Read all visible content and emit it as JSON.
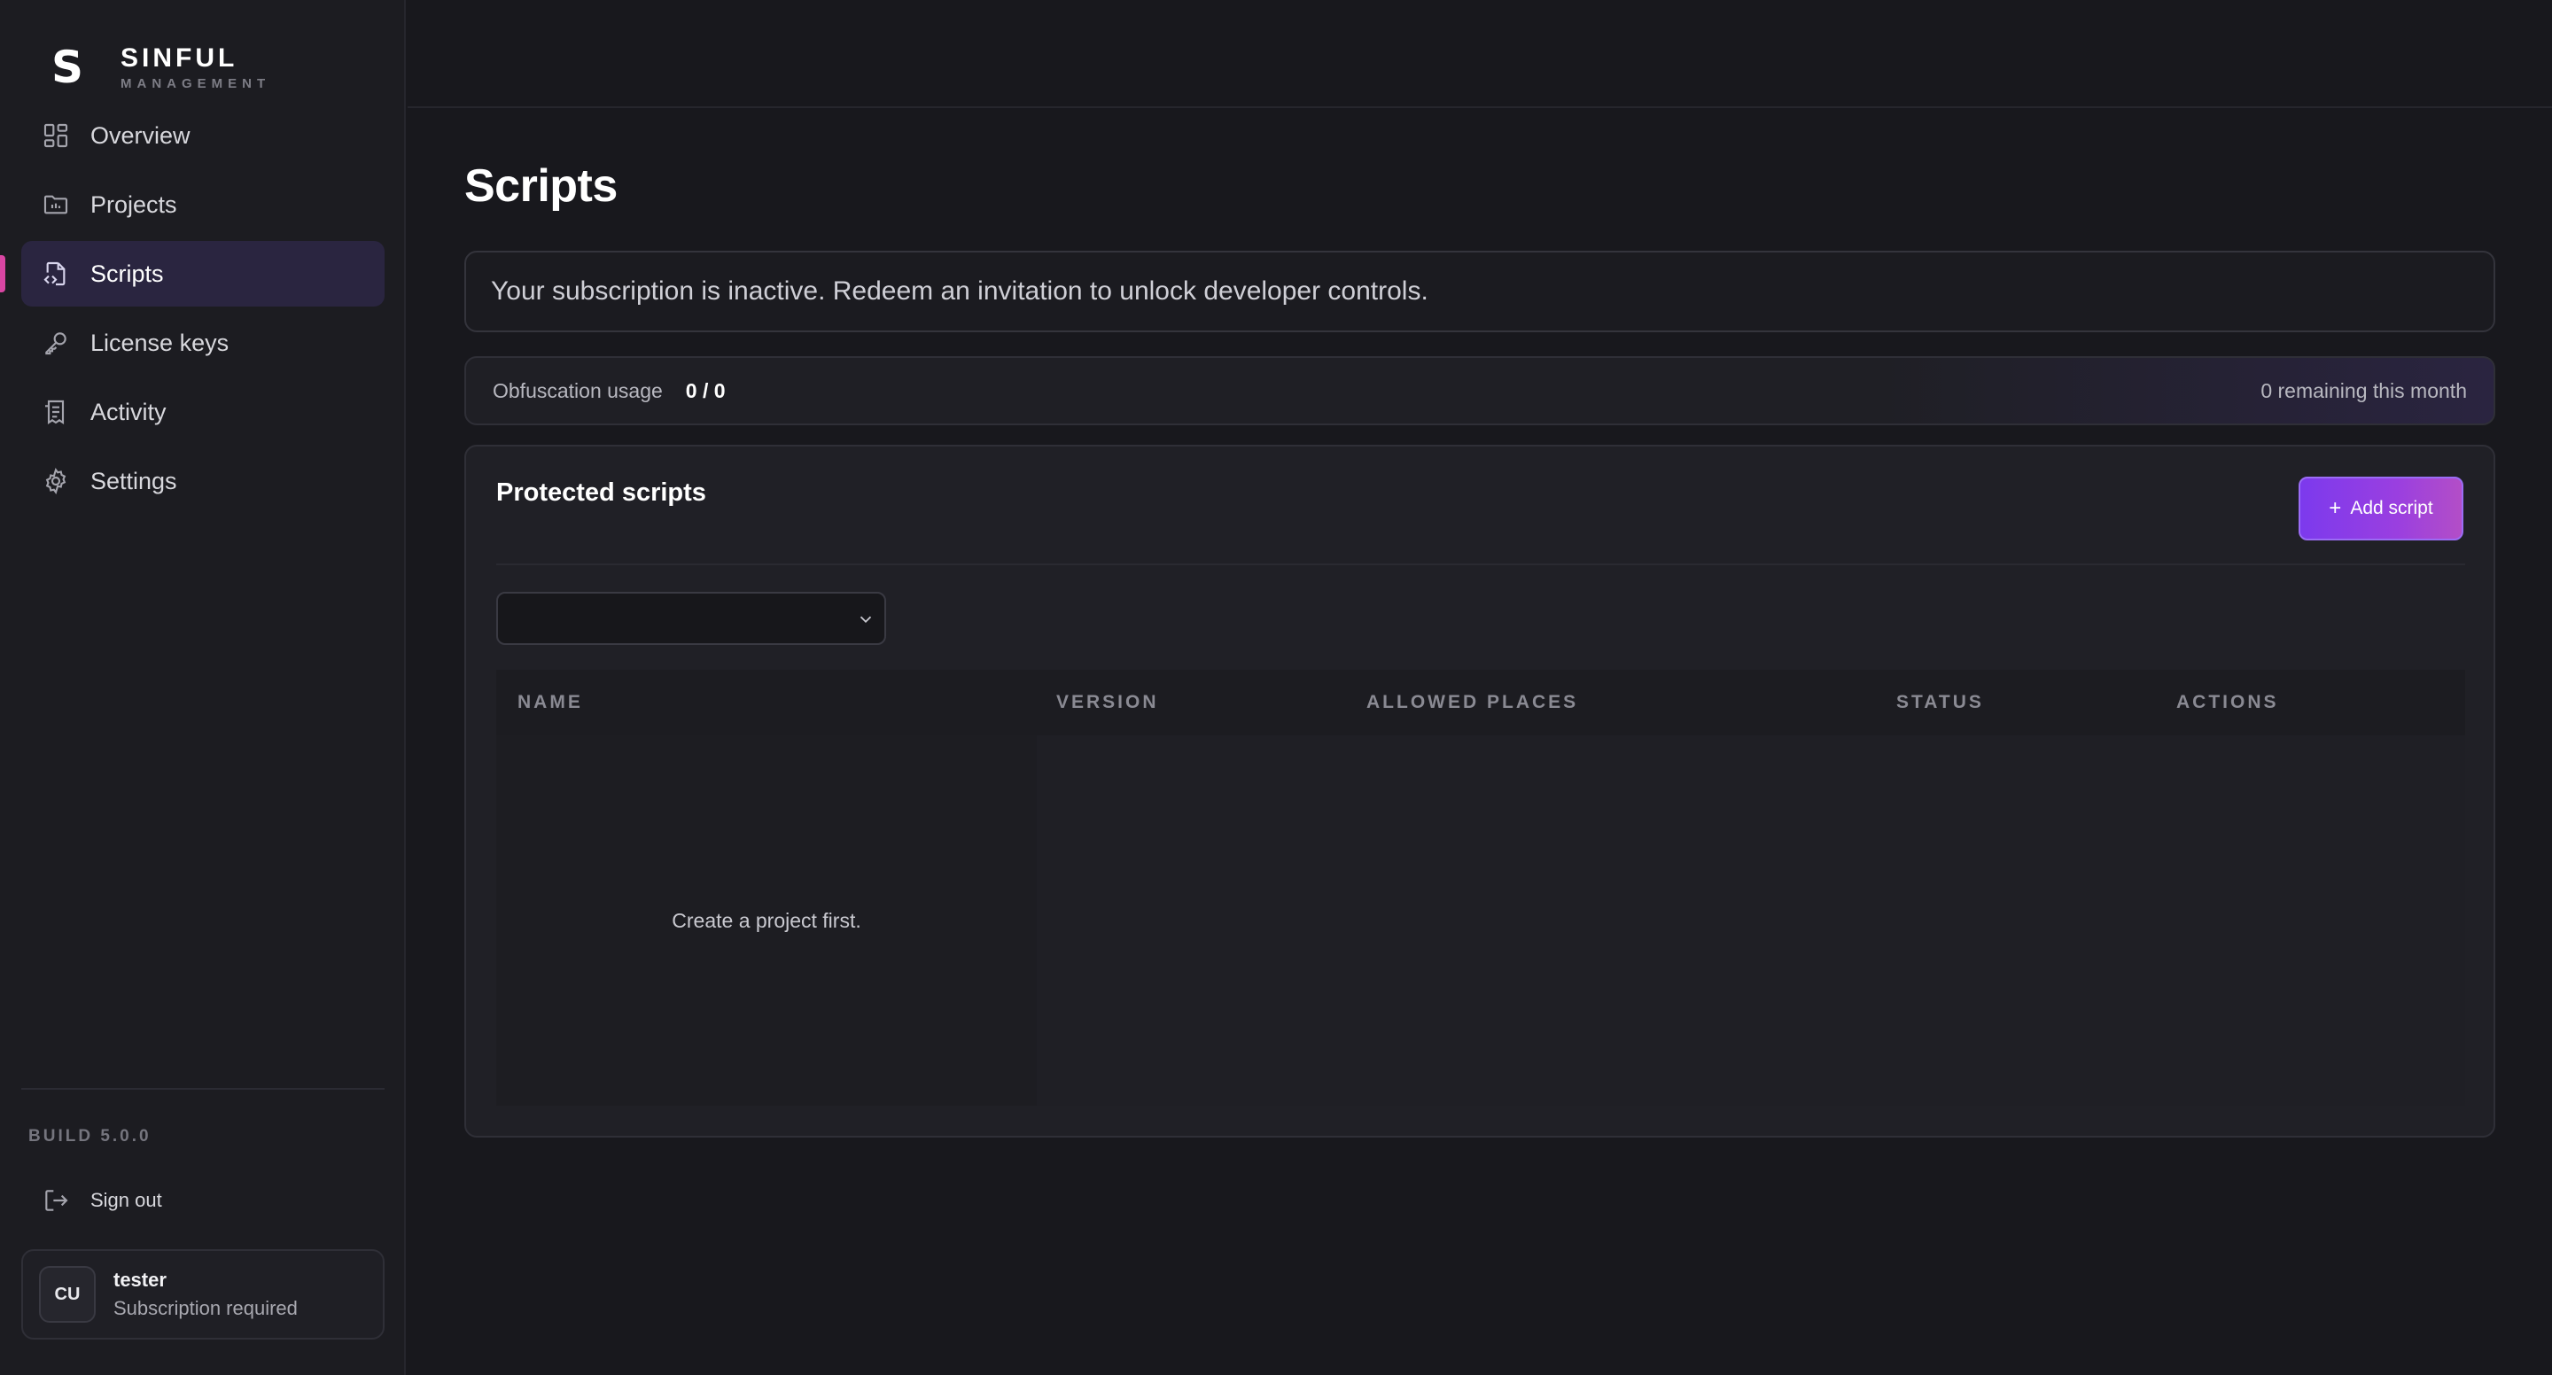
{
  "brand": {
    "logo_letter": "S",
    "title": "SINFUL",
    "subtitle": "MANAGEMENT"
  },
  "sidebar": {
    "items": [
      {
        "label": "Overview",
        "icon": "grid-icon",
        "active": false
      },
      {
        "label": "Projects",
        "icon": "folder-chart-icon",
        "active": false
      },
      {
        "label": "Scripts",
        "icon": "file-code-icon",
        "active": true
      },
      {
        "label": "License keys",
        "icon": "key-icon",
        "active": false
      },
      {
        "label": "Activity",
        "icon": "receipt-icon",
        "active": false
      },
      {
        "label": "Settings",
        "icon": "gear-icon",
        "active": false
      }
    ],
    "build": "BUILD 5.0.0",
    "sign_out": "Sign out",
    "user": {
      "initials": "CU",
      "name": "tester",
      "status": "Subscription required"
    }
  },
  "main": {
    "title": "Scripts",
    "banner": "Your subscription is inactive. Redeem an invitation to unlock developer controls.",
    "usage": {
      "label": "Obfuscation usage",
      "value": "0 / 0",
      "remaining": "0 remaining this month"
    },
    "panel": {
      "title": "Protected scripts",
      "add_button": "Add script",
      "add_icon": "plus-icon",
      "select_value": "",
      "columns": [
        "NAME",
        "VERSION",
        "ALLOWED PLACES",
        "STATUS",
        "ACTIONS"
      ],
      "empty_message": "Create a project first."
    }
  },
  "colors": {
    "background": "#18181d",
    "sidebar": "#1c1c21",
    "accent": "#7c3aed",
    "active_indicator": "#d946a3",
    "active_bg": "#2a2540"
  }
}
